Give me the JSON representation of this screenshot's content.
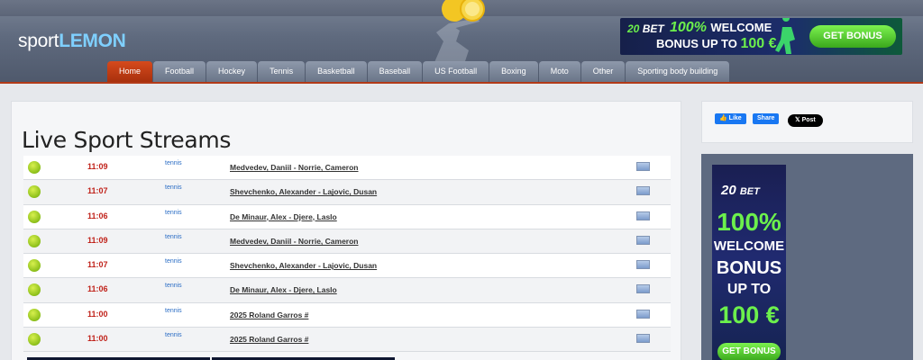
{
  "header": {
    "logo_prefix": "sport",
    "logo_suffix": "LEMON"
  },
  "ad_banner": {
    "brand_num": "20",
    "brand_word": "BET",
    "line1_pct": "100%",
    "line1_word": "WELCOME",
    "line2_text": "BONUS UP TO",
    "line2_amount": "100 €",
    "button": "GET BONUS"
  },
  "nav": {
    "tabs": [
      {
        "label": "Home",
        "active": true
      },
      {
        "label": "Football"
      },
      {
        "label": "Hockey"
      },
      {
        "label": "Tennis"
      },
      {
        "label": "Basketball"
      },
      {
        "label": "Baseball"
      },
      {
        "label": "US Football"
      },
      {
        "label": "Boxing"
      },
      {
        "label": "Moto"
      },
      {
        "label": "Other"
      },
      {
        "label": "Sporting body building"
      }
    ]
  },
  "main": {
    "title": "Live Sport Streams",
    "rows": [
      {
        "time": "11:09",
        "sport": "tennis",
        "match": "Medvedev, Daniil - Norrie, Cameron"
      },
      {
        "time": "11:07",
        "sport": "tennis",
        "match": "Shevchenko, Alexander - Lajovic, Dusan"
      },
      {
        "time": "11:06",
        "sport": "tennis",
        "match": "De Minaur, Alex - Djere, Laslo"
      },
      {
        "time": "11:09",
        "sport": "tennis",
        "match": "Medvedev, Daniil - Norrie, Cameron"
      },
      {
        "time": "11:07",
        "sport": "tennis",
        "match": "Shevchenko, Alexander - Lajovic, Dusan"
      },
      {
        "time": "11:06",
        "sport": "tennis",
        "match": "De Minaur, Alex - Djere, Laslo"
      },
      {
        "time": "11:00",
        "sport": "tennis",
        "match": "2025 Roland Garros #"
      },
      {
        "time": "11:00",
        "sport": "tennis",
        "match": "2025 Roland Garros #"
      }
    ]
  },
  "social": {
    "like": "Like",
    "share": "Share",
    "post": "Post"
  },
  "side_banner": {
    "brand_num": "20",
    "brand_word": "BET",
    "pct": "100%",
    "welcome": "WELCOME",
    "bonus": "BONUS",
    "up_to": "UP TO",
    "amount": "100 €",
    "button": "GET BONUS"
  }
}
